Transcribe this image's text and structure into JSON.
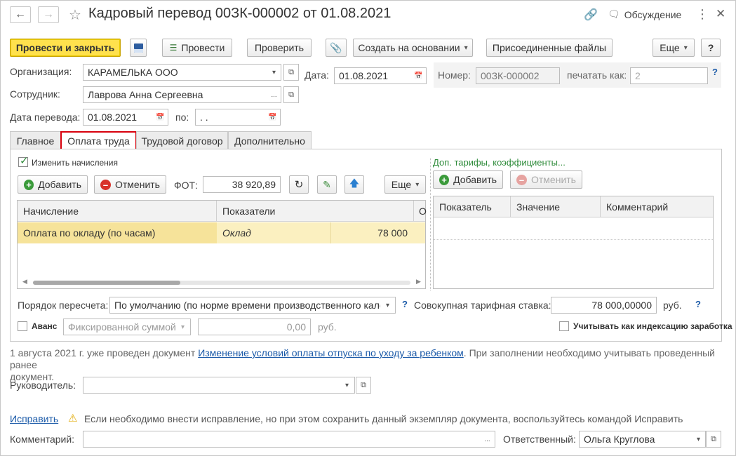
{
  "window": {
    "title": "Кадровый перевод 00ЗК-000002 от 01.08.2021",
    "discussion_label": "Обсуждение"
  },
  "toolbar": {
    "post_and_close": "Провести и закрыть",
    "post": "Провести",
    "check": "Проверить",
    "create_based_on": "Создать на основании",
    "attached_files": "Присоединенные файлы",
    "more": "Еще",
    "help": "?"
  },
  "header": {
    "org_label": "Организация:",
    "org_value": "КАРАМЕЛЬКА ООО",
    "date_label": "Дата:",
    "date_value": "01.08.2021",
    "number_label": "Номер:",
    "number_value": "00ЗК-000002",
    "print_as_label": "печатать как:",
    "print_as_value": "2",
    "employee_label": "Сотрудник:",
    "employee_value": "Лаврова Анна Сергеевна",
    "transfer_date_label": "Дата перевода:",
    "transfer_date_value": "01.08.2021",
    "to_label": "по:",
    "to_value": " .  ."
  },
  "tabs": [
    {
      "label": "Главное"
    },
    {
      "label": "Оплата труда"
    },
    {
      "label": "Трудовой договор"
    },
    {
      "label": "Дополнительно"
    }
  ],
  "pay": {
    "change_accruals_label": "Изменить начисления",
    "add": "Добавить",
    "cancel": "Отменить",
    "fot_label": "ФОТ:",
    "fot_value": "38 920,89",
    "more": "Еще",
    "columns": [
      "Начисление",
      "Показатели",
      "О"
    ],
    "rows": [
      {
        "accrual": "Оплата по окладу (по часам)",
        "indicator": "Оклад",
        "value": "78 000"
      }
    ],
    "tariffs_link": "Доп. тарифы, коэффициенты...",
    "add2": "Добавить",
    "cancel2": "Отменить",
    "columns2": [
      "Показатель",
      "Значение",
      "Комментарий"
    ],
    "recalc_label": "Порядок пересчета:",
    "recalc_value": "По умолчанию (по норме времени производственного календ",
    "total_rate_label": "Совокупная тарифная ставка:",
    "total_rate_value": "78 000,00000",
    "currency": "руб.",
    "advance_label": "Аванс",
    "advance_type": "Фиксированной суммой",
    "advance_value": "0,00",
    "advance_currency": "руб.",
    "indexation_label": "Учитывать как индексацию заработка"
  },
  "notice": {
    "prefix": "1 августа 2021 г. уже проведен документ ",
    "link": "Изменение условий оплаты отпуска по уходу за ребенком",
    "suffix": ". При заполнении необходимо учитывать проведенный ранее",
    "line2": "документ."
  },
  "footer": {
    "manager_label": "Руководитель:",
    "manager_value": "",
    "fix_link": "Исправить",
    "fix_hint": "Если необходимо внести исправление, но при этом сохранить данный экземпляр документа, воспользуйтесь командой Исправить",
    "comment_label": "Комментарий:",
    "comment_value": "",
    "responsible_label": "Ответственный:",
    "responsible_value": "Ольга Круглова"
  }
}
